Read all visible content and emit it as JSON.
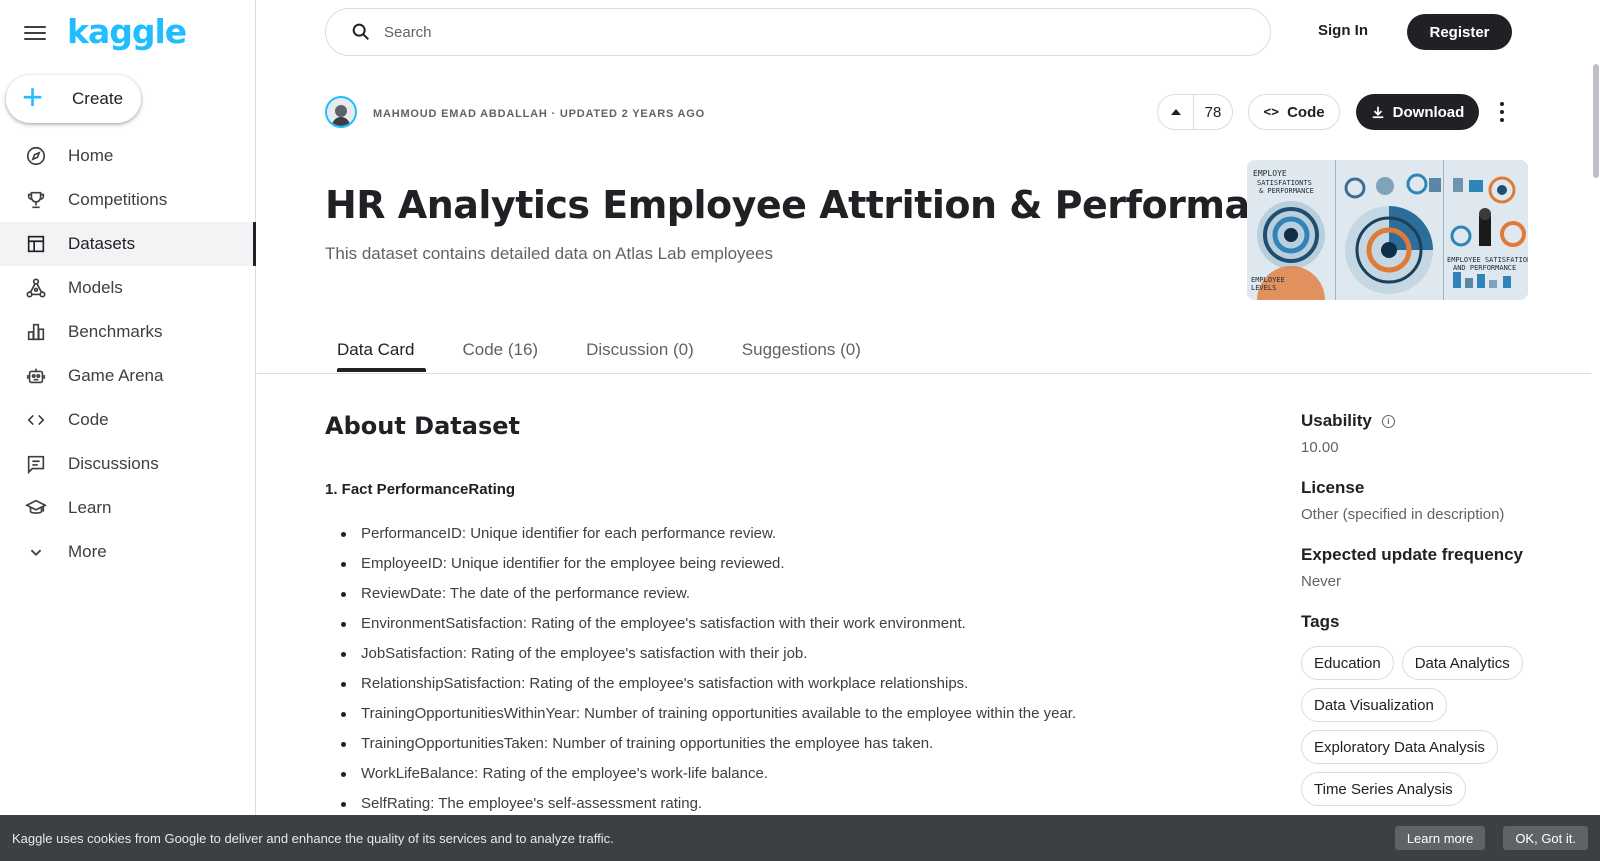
{
  "brand": {
    "logo_text": "kaggle",
    "accent": "#20beff"
  },
  "sidebar": {
    "create_label": "Create",
    "items": [
      {
        "label": "Home",
        "icon": "compass-icon"
      },
      {
        "label": "Competitions",
        "icon": "trophy-icon"
      },
      {
        "label": "Datasets",
        "icon": "table-icon",
        "active": true
      },
      {
        "label": "Models",
        "icon": "models-icon"
      },
      {
        "label": "Benchmarks",
        "icon": "bar-chart-icon"
      },
      {
        "label": "Game Arena",
        "icon": "robot-icon"
      },
      {
        "label": "Code",
        "icon": "code-icon"
      },
      {
        "label": "Discussions",
        "icon": "comment-icon"
      },
      {
        "label": "Learn",
        "icon": "graduation-cap-icon"
      },
      {
        "label": "More",
        "icon": "chevron-down-icon"
      }
    ]
  },
  "topbar": {
    "search_placeholder": "Search",
    "signin_label": "Sign In",
    "register_label": "Register"
  },
  "dataset": {
    "owner_line": "MAHMOUD EMAD ABDALLAH · UPDATED 2 YEARS AGO",
    "vote_count": "78",
    "code_label": "Code",
    "download_label": "Download",
    "title": "HR Analytics Employee Attrition & Performance",
    "subtitle": "This dataset contains detailed data on Atlas Lab employees",
    "cover_text_top": "EMPLOYE SATISFATIONTS & PERFORMANCE",
    "cover_text_right": "EMPLOYEE SATISFATION AND PERFORMANCE",
    "cover_text_bottom": "EMPLOYEE LEVELS"
  },
  "tabs": [
    {
      "label": "Data Card",
      "active": true
    },
    {
      "label": "Code (16)"
    },
    {
      "label": "Discussion (0)"
    },
    {
      "label": "Suggestions (0)"
    }
  ],
  "about": {
    "title": "About Dataset",
    "section_title": "1. Fact PerformanceRating",
    "fields": [
      "PerformanceID: Unique identifier for each performance review.",
      "EmployeeID: Unique identifier for the employee being reviewed.",
      "ReviewDate: The date of the performance review.",
      "EnvironmentSatisfaction: Rating of the employee's satisfaction with their work environment.",
      "JobSatisfaction: Rating of the employee's satisfaction with their job.",
      "RelationshipSatisfaction: Rating of the employee's satisfaction with workplace relationships.",
      "TrainingOpportunitiesWithinYear: Number of training opportunities available to the employee within the year.",
      "TrainingOpportunitiesTaken: Number of training opportunities the employee has taken.",
      "WorkLifeBalance: Rating of the employee's work-life balance.",
      "SelfRating: The employee's self-assessment rating."
    ]
  },
  "meta": {
    "usability_label": "Usability",
    "usability_value": "10.00",
    "license_label": "License",
    "license_value": "Other (specified in description)",
    "frequency_label": "Expected update frequency",
    "frequency_value": "Never",
    "tags_label": "Tags",
    "tags": [
      "Education",
      "Data Analytics",
      "Data Visualization",
      "Exploratory Data Analysis",
      "Time Series Analysis"
    ]
  },
  "cookie": {
    "text": "Kaggle uses cookies from Google to deliver and enhance the quality of its services and to analyze traffic.",
    "learn_more": "Learn more",
    "ok": "OK, Got it."
  }
}
